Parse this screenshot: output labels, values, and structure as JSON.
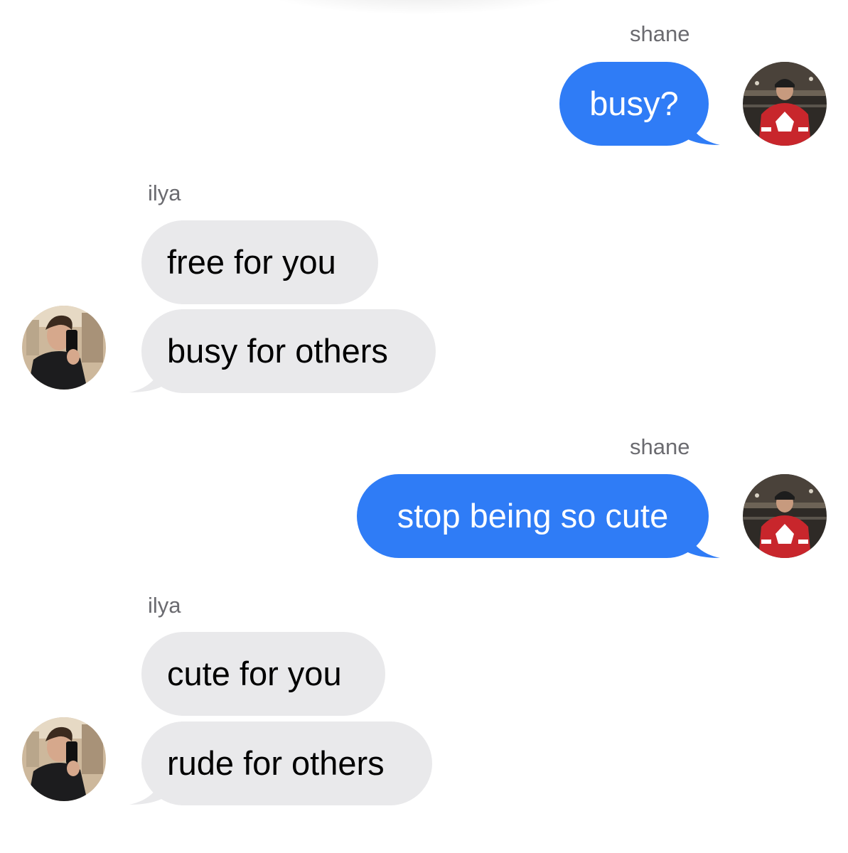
{
  "thread": {
    "groups": [
      {
        "sender": "shane",
        "direction": "outgoing",
        "messages": [
          "busy?"
        ]
      },
      {
        "sender": "ilya",
        "direction": "incoming",
        "messages": [
          "free for you",
          "busy for others"
        ]
      },
      {
        "sender": "shane",
        "direction": "outgoing",
        "messages": [
          "stop being so cute"
        ]
      },
      {
        "sender": "ilya",
        "direction": "incoming",
        "messages": [
          "cute for you",
          "rude for others"
        ]
      }
    ]
  },
  "colors": {
    "outgoing_bubble": "#2f7cf6",
    "incoming_bubble": "#e9e9eb",
    "sender_label": "#6b6b70"
  },
  "icons": {
    "shane_avatar": "avatar-hockey-jersey",
    "ilya_avatar": "avatar-mirror-selfie"
  }
}
